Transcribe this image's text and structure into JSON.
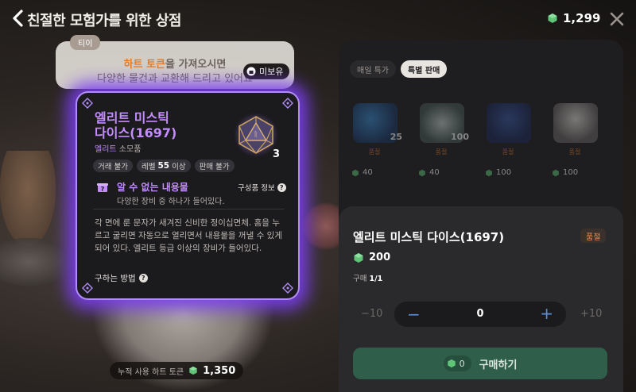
{
  "header": {
    "title": "친절한 모험가를 위한 상점",
    "currency_amount": "1,299"
  },
  "npc": {
    "speaker": "티이",
    "line1_highlight": "하트 토큰",
    "line1_rest": "을 가져오시면",
    "line2": "다양한 물건과 교환해 드리고 있어요",
    "unowned_label": "미보유"
  },
  "item_card": {
    "name_line1": "엘리트 미스틱",
    "name_line2": "다이스(1697)",
    "grade": "엘리트",
    "kind": "소모품",
    "count": "3",
    "tags": {
      "trade": "거래 불가",
      "level_prefix": "레벨",
      "level_value": "55",
      "level_suffix": "이상",
      "sell": "판매 불가"
    },
    "unknown_title": "알 수 없는 내용물",
    "unknown_desc": "다양한 장비 중 하나가 들어있다.",
    "components_link": "구성품 정보",
    "description": "각 면에 룬 문자가 새겨진 신비한 정이십면체. 홈을 누르고 굴리면 자동으로 열리면서 내용물을 꺼낼 수 있게 되어 있다. 엘리트 등급 이상의 장비가 들어있다.",
    "howto_link": "구하는 방법"
  },
  "total_spent": {
    "label": "누적 사용 하트 토큰",
    "value": "1,350"
  },
  "shop": {
    "tabs": [
      "매일 특가",
      "특별 판매"
    ],
    "active_tab": 1,
    "items": [
      {
        "qty": "25",
        "status": "품절",
        "price": "40",
        "color": "#2e6fb0"
      },
      {
        "qty": "100",
        "status": "품절",
        "price": "40",
        "color": "#6f8f8a"
      },
      {
        "qty": "",
        "status": "품절",
        "price": "100",
        "color": "#2a3f7a"
      },
      {
        "qty": "",
        "status": "품절",
        "price": "100",
        "color": "#7a7878"
      }
    ]
  },
  "buy": {
    "name": "엘리트 미스틱 다이스(1697)",
    "status": "품절",
    "price": "200",
    "limit_label": "구매",
    "limit_value": "1/1",
    "minus10": "−10",
    "plus10": "+10",
    "minus": "−",
    "plus": "+",
    "quantity": "0",
    "cost": "0",
    "button_label": "구매하기"
  },
  "colors": {
    "accent_purple": "#c38cff",
    "gem_green": "#5fc478",
    "sold_out": "#e07d2c",
    "buy_button": "#2f5f4b"
  }
}
